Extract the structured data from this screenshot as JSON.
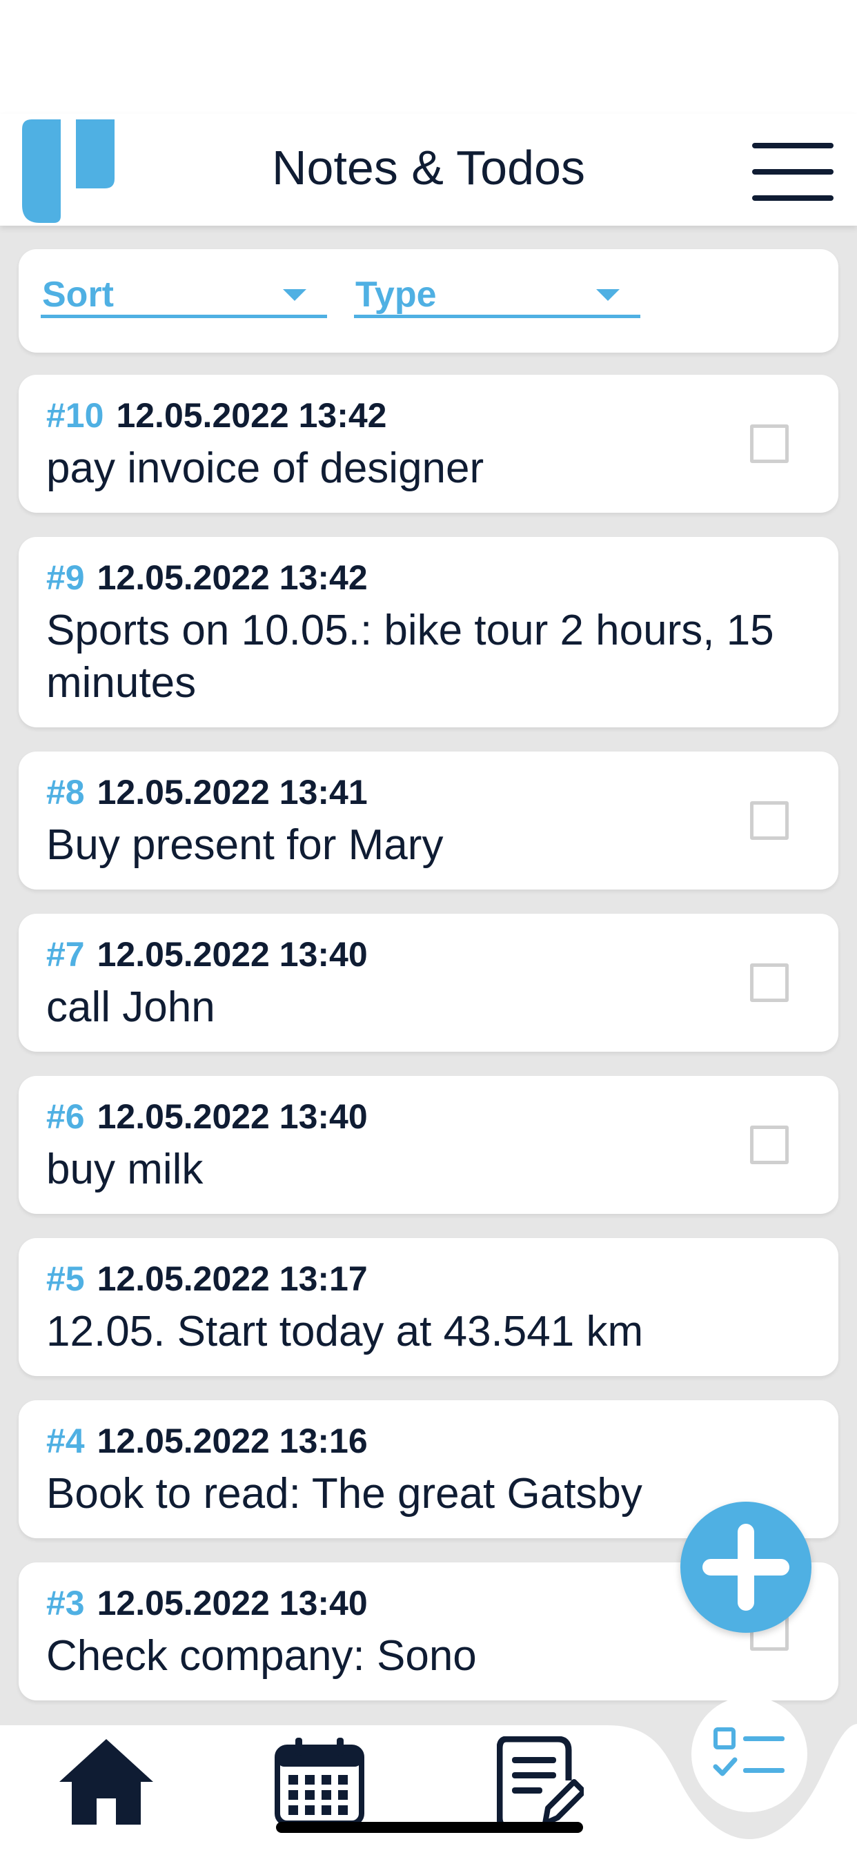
{
  "header": {
    "title": "Notes & Todos",
    "brand_color": "#4fb0e3",
    "text_color": "#0f1c33"
  },
  "filters": {
    "sort_label": "Sort",
    "type_label": "Type"
  },
  "notes": [
    {
      "id": "#10",
      "date": "12.05.2022 13:42",
      "text": "pay invoice of designer",
      "is_todo": true,
      "checked": false
    },
    {
      "id": "#9",
      "date": "12.05.2022 13:42",
      "text": "Sports on 10.05.: bike tour 2 hours, 15 minutes",
      "is_todo": false
    },
    {
      "id": "#8",
      "date": "12.05.2022 13:41",
      "text": "Buy present for Mary",
      "is_todo": true,
      "checked": false
    },
    {
      "id": "#7",
      "date": "12.05.2022 13:40",
      "text": "call John",
      "is_todo": true,
      "checked": false
    },
    {
      "id": "#6",
      "date": "12.05.2022 13:40",
      "text": "buy milk",
      "is_todo": true,
      "checked": false
    },
    {
      "id": "#5",
      "date": "12.05.2022 13:17",
      "text": "12.05. Start today at 43.541 km",
      "is_todo": false
    },
    {
      "id": "#4",
      "date": "12.05.2022 13:16",
      "text": "Book to read: The great Gatsby",
      "is_todo": false
    },
    {
      "id": "#3",
      "date": "12.05.2022 13:40",
      "text": "Check company: Sono",
      "is_todo": true,
      "checked": false
    }
  ],
  "icons": {
    "logo": "app-logo",
    "menu": "hamburger-menu-icon",
    "fab": "plus-icon",
    "nav_home": "home-icon",
    "nav_calendar": "calendar-icon",
    "nav_notes": "note-edit-icon",
    "nav_todos": "checklist-icon"
  }
}
